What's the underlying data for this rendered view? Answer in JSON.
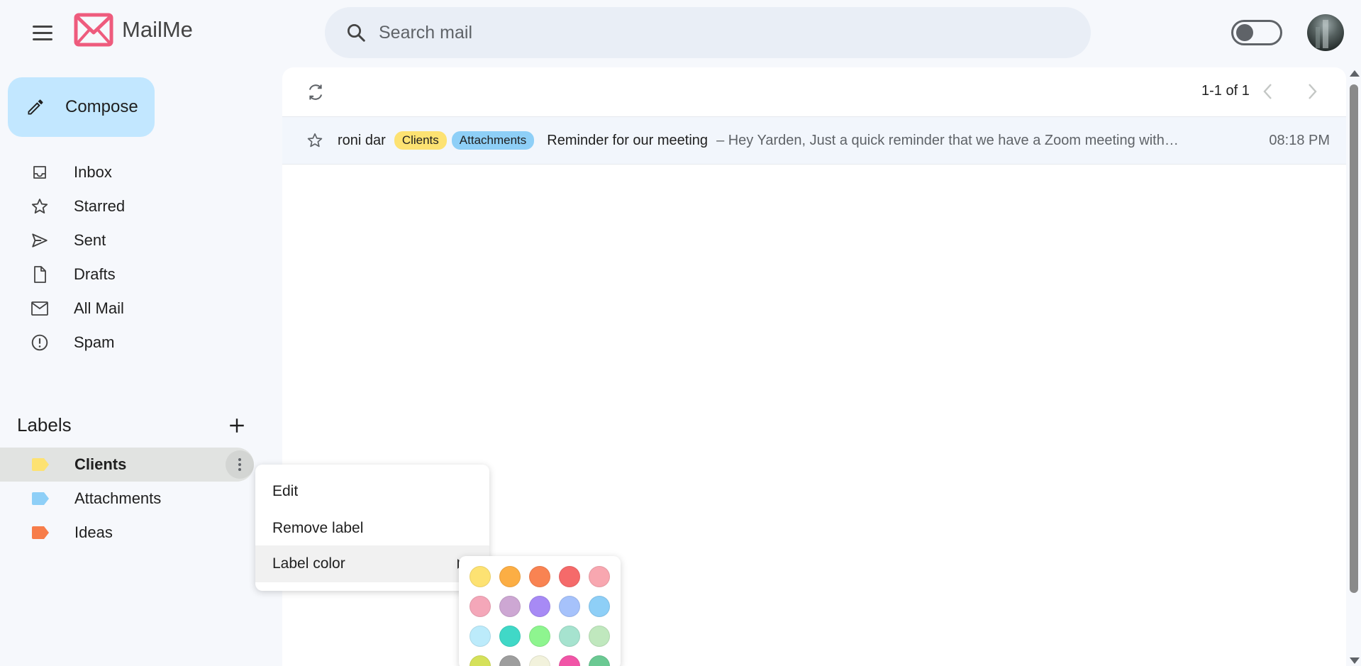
{
  "app": {
    "name": "MailMe"
  },
  "search": {
    "placeholder": "Search mail",
    "value": ""
  },
  "compose": {
    "label": "Compose"
  },
  "nav": {
    "items": [
      {
        "label": "Inbox",
        "icon": "inbox-icon"
      },
      {
        "label": "Starred",
        "icon": "star-icon"
      },
      {
        "label": "Sent",
        "icon": "send-icon"
      },
      {
        "label": "Drafts",
        "icon": "draft-icon"
      },
      {
        "label": "All Mail",
        "icon": "mail-icon"
      },
      {
        "label": "Spam",
        "icon": "spam-icon"
      }
    ]
  },
  "labels": {
    "title": "Labels",
    "items": [
      {
        "label": "Clients",
        "color": "#fde272",
        "active": true
      },
      {
        "label": "Attachments",
        "color": "#8ecff7",
        "active": false
      },
      {
        "label": "Ideas",
        "color": "#f77d4a",
        "active": false
      }
    ]
  },
  "pager": {
    "text": "1-1 of 1"
  },
  "emails": [
    {
      "sender": "roni dar",
      "tags": [
        {
          "label": "Clients",
          "color": "#fde272"
        },
        {
          "label": "Attachments",
          "color": "#8ecff7"
        }
      ],
      "subject": "Reminder for our meeting",
      "snippet": "– Hey Yarden, Just a quick reminder that we have a Zoom meeting with…",
      "time": "08:18 PM"
    }
  ],
  "context_menu": {
    "items": [
      {
        "label": "Edit"
      },
      {
        "label": "Remove label"
      },
      {
        "label": "Label color"
      }
    ]
  },
  "palette": {
    "colors": [
      [
        "#fde272",
        "#fcae44",
        "#f98352",
        "#f56a6a",
        "#f8a7b0"
      ],
      [
        "#f4a7b9",
        "#cda7d3",
        "#a78af5",
        "#a6c2fb",
        "#8ecff7"
      ],
      [
        "#bcebfb",
        "#40d8c7",
        "#8ef58f",
        "#a6e3cf",
        "#c0e8be"
      ],
      [
        "#d5e15a",
        "#9e9e9e",
        "#f2f2dc",
        "#f155a7",
        "#6bc993"
      ]
    ]
  }
}
